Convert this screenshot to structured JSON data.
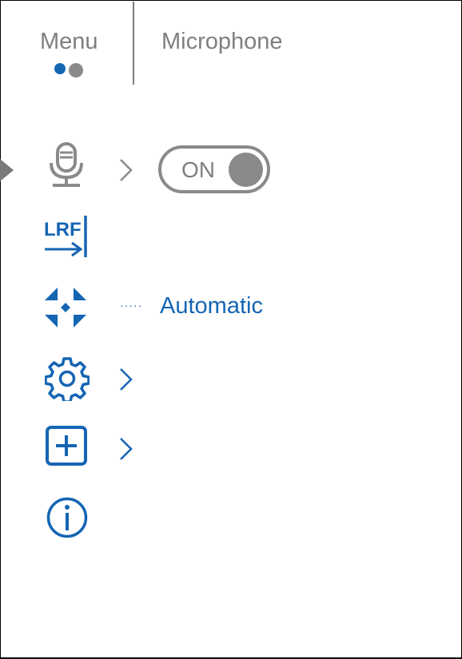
{
  "header": {
    "menu_label": "Menu",
    "title": "Microphone",
    "page_indicator": {
      "current": 1,
      "total": 2
    }
  },
  "colors": {
    "accent": "#1565b3",
    "inactive": "#8a8a8a",
    "text_gray": "#7f7f7f"
  },
  "menu_items": [
    {
      "icon": "microphone-icon",
      "has_submenu": true,
      "selected": true,
      "toggle": {
        "label": "ON",
        "state": true
      }
    },
    {
      "icon": "lrf-icon",
      "has_submenu": false,
      "icon_text": "LRF"
    },
    {
      "icon": "auto-mode-icon",
      "has_submenu": false,
      "value": "Automatic"
    },
    {
      "icon": "gear-icon",
      "has_submenu": true
    },
    {
      "icon": "add-icon",
      "has_submenu": true
    },
    {
      "icon": "info-icon",
      "has_submenu": false
    }
  ]
}
